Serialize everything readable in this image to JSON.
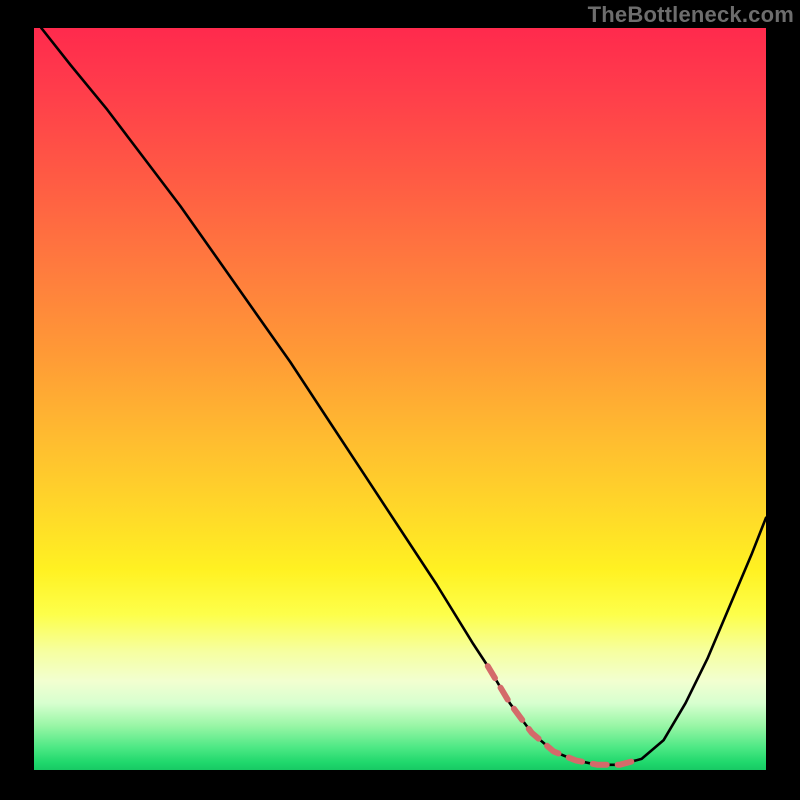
{
  "watermark": "TheBottleneck.com",
  "chart_data": {
    "type": "line",
    "title": "",
    "xlabel": "",
    "ylabel": "",
    "xlim": [
      0,
      100
    ],
    "ylim": [
      0,
      100
    ],
    "grid": false,
    "legend": false,
    "description": "Bottleneck curve: black V-shaped line over vertical rainbow gradient (red top to green bottom). Dashed red segment marks the optimal range near the minimum.",
    "series": [
      {
        "name": "bottleneck-curve",
        "color": "#000000",
        "style": "solid",
        "x": [
          1,
          5,
          10,
          15,
          20,
          25,
          30,
          35,
          40,
          45,
          50,
          55,
          60,
          62,
          65,
          68,
          71,
          74,
          77,
          80,
          83,
          86,
          89,
          92,
          95,
          98,
          100
        ],
        "y": [
          100,
          95,
          89,
          82.5,
          76,
          69,
          62,
          55,
          47.5,
          40,
          32.5,
          25,
          17,
          14,
          9,
          5,
          2.5,
          1.3,
          0.7,
          0.7,
          1.5,
          4,
          9,
          15,
          22,
          29,
          34
        ]
      },
      {
        "name": "optimal-range",
        "color": "#d46a6a",
        "style": "dashed",
        "x": [
          62,
          65,
          68,
          71,
          74,
          77,
          80,
          83
        ],
        "y": [
          14,
          9,
          5,
          2.5,
          1.3,
          0.7,
          0.7,
          1.5
        ]
      }
    ],
    "gradient_stops": [
      {
        "pos": 0,
        "color": "#ff2a4d"
      },
      {
        "pos": 50,
        "color": "#ffc030"
      },
      {
        "pos": 78,
        "color": "#fff84a"
      },
      {
        "pos": 100,
        "color": "#18c964"
      }
    ]
  }
}
